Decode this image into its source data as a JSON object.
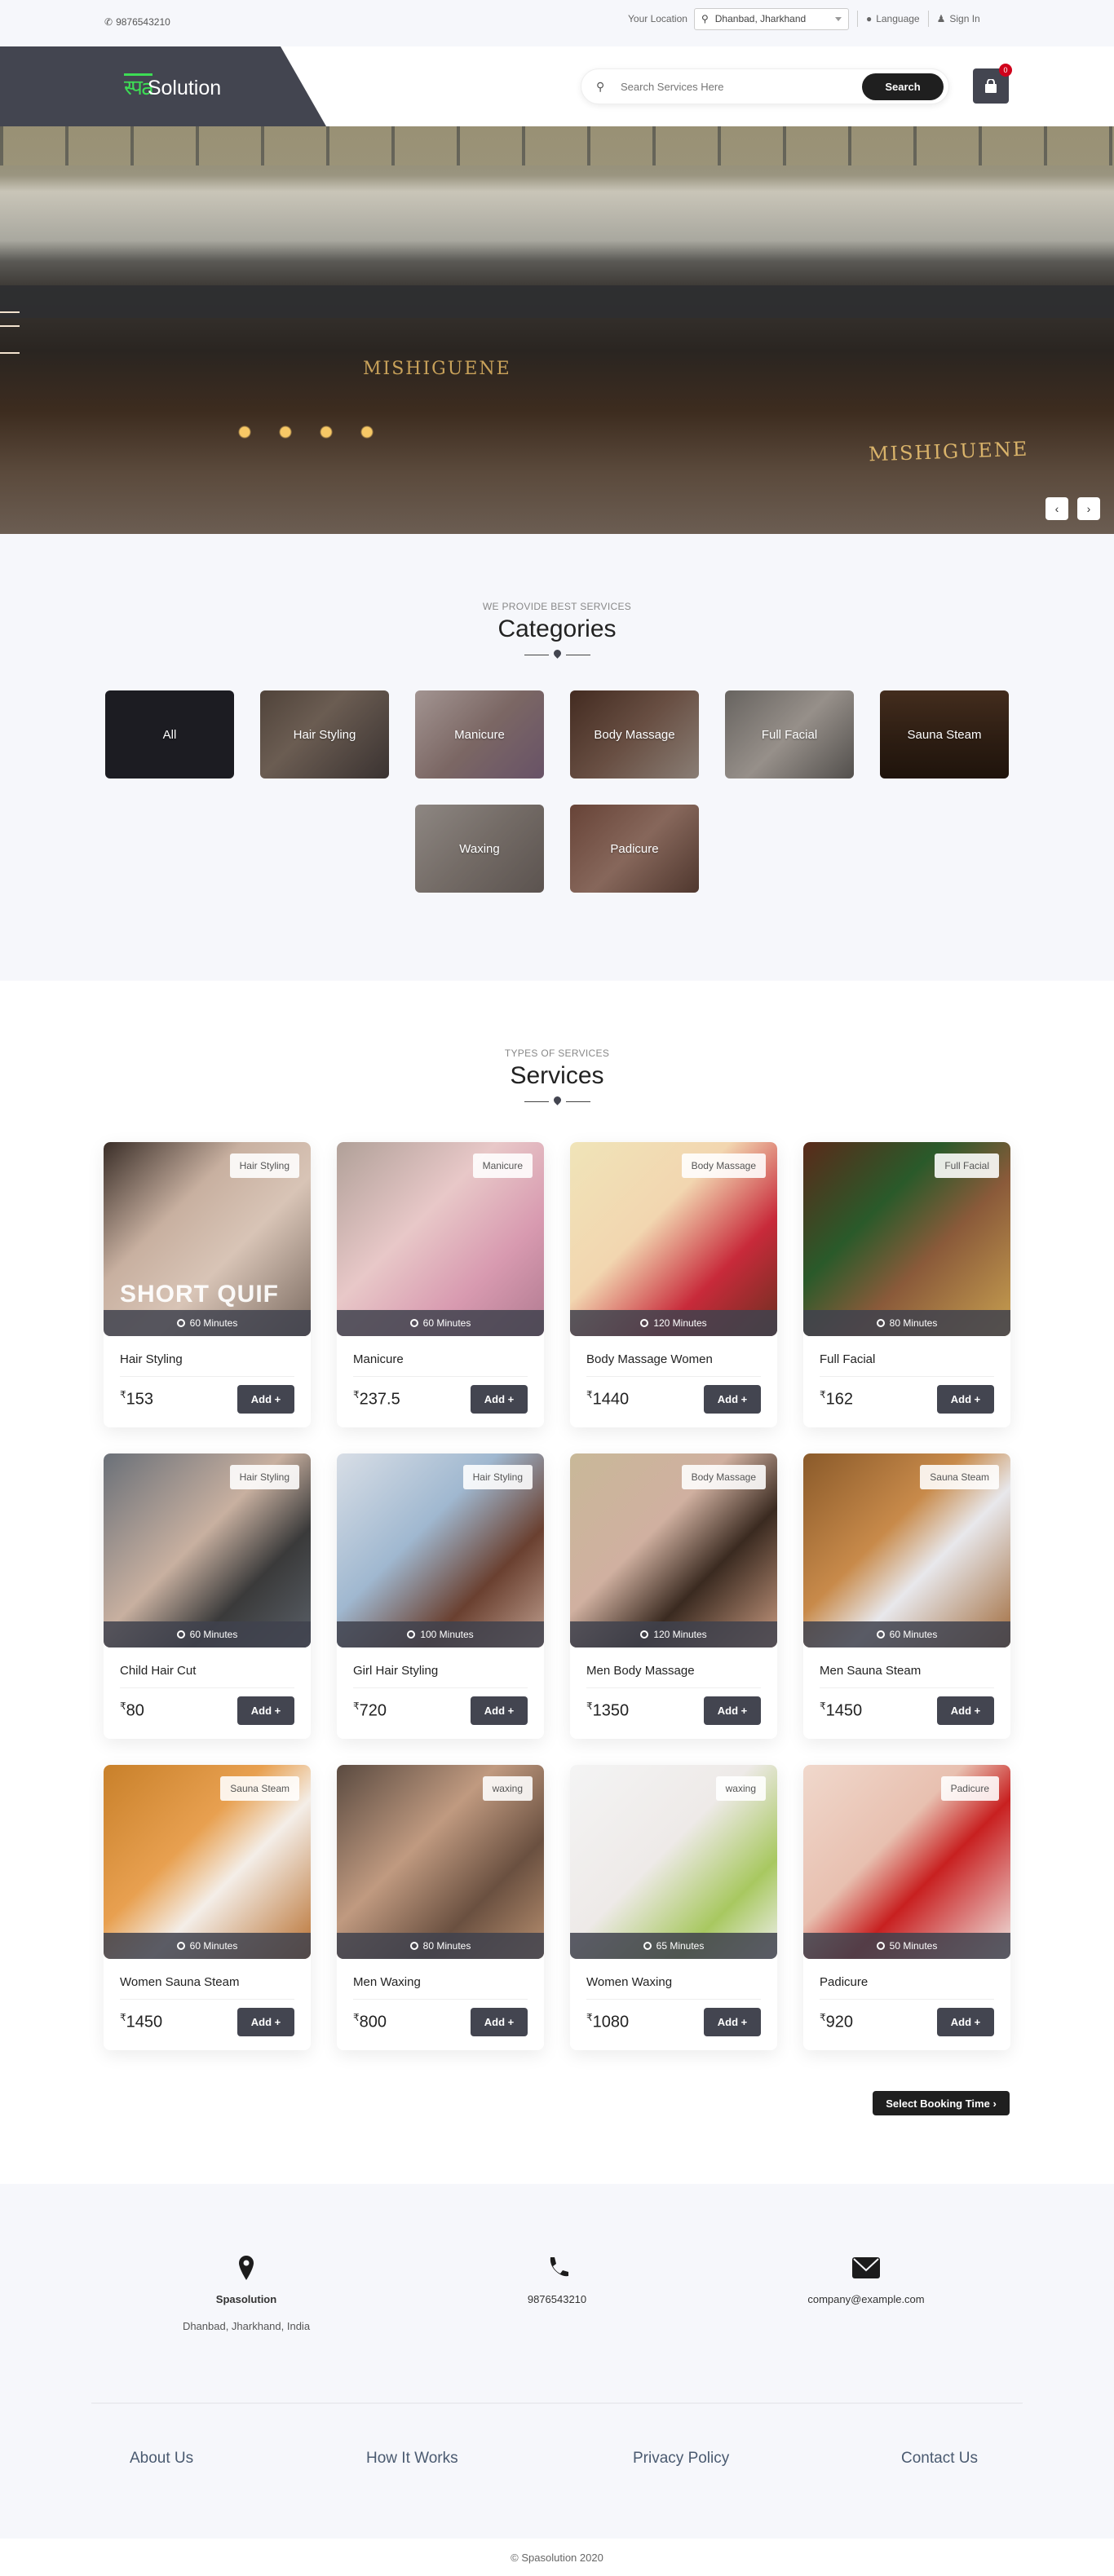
{
  "topbar": {
    "phone": "9876543210",
    "location_label": "Your Location",
    "location_value": "Dhanbad, Jharkhand",
    "language": "Language",
    "sign_in": "Sign In"
  },
  "header": {
    "logo_spa": "स्पa",
    "logo_solution": "Solution",
    "search_placeholder": "Search Services Here",
    "search_button": "Search",
    "cart_count": "0"
  },
  "hero": {
    "sign_left": "MISHIGUENE",
    "sign_right": "MISHIGUENE",
    "prev_icon": "‹",
    "next_icon": "›"
  },
  "categories": {
    "subtitle": "WE PROVIDE BEST SERVICES",
    "title": "Categories",
    "items": [
      {
        "label": "All"
      },
      {
        "label": "Hair Styling"
      },
      {
        "label": "Manicure"
      },
      {
        "label": "Body Massage"
      },
      {
        "label": "Full Facial"
      },
      {
        "label": "Sauna Steam"
      },
      {
        "label": "Waxing"
      },
      {
        "label": "Padicure"
      }
    ]
  },
  "services": {
    "subtitle": "TYPES OF SERVICES",
    "title": "Services",
    "currency": "₹",
    "add_label": "Add +",
    "items": [
      {
        "name": "Hair Styling",
        "tag": "Hair Styling",
        "duration": "60 Minutes",
        "price": "153"
      },
      {
        "name": "Manicure",
        "tag": "Manicure",
        "duration": "60 Minutes",
        "price": "237.5"
      },
      {
        "name": "Body Massage Women",
        "tag": "Body Massage",
        "duration": "120 Minutes",
        "price": "1440"
      },
      {
        "name": "Full Facial",
        "tag": "Full Facial",
        "duration": "80 Minutes",
        "price": "162"
      },
      {
        "name": "Child Hair Cut",
        "tag": "Hair Styling",
        "duration": "60 Minutes",
        "price": "80"
      },
      {
        "name": "Girl Hair Styling",
        "tag": "Hair Styling",
        "duration": "100 Minutes",
        "price": "720"
      },
      {
        "name": "Men Body Massage",
        "tag": "Body Massage",
        "duration": "120 Minutes",
        "price": "1350"
      },
      {
        "name": "Men Sauna Steam",
        "tag": "Sauna Steam",
        "duration": "60 Minutes",
        "price": "1450"
      },
      {
        "name": "Women Sauna Steam",
        "tag": "Sauna Steam",
        "duration": "60 Minutes",
        "price": "1450"
      },
      {
        "name": "Men Waxing",
        "tag": "waxing",
        "duration": "80 Minutes",
        "price": "800"
      },
      {
        "name": "Women Waxing",
        "tag": "waxing",
        "duration": "65 Minutes",
        "price": "1080"
      },
      {
        "name": "Padicure",
        "tag": "Padicure",
        "duration": "50 Minutes",
        "price": "920"
      }
    ],
    "image_overlay_text": "SHORT QUIF",
    "book_button": "Select Booking Time ›"
  },
  "footer": {
    "company": "Spasolution",
    "address": "Dhanbad, Jharkhand, India",
    "phone": "9876543210",
    "email": "company@example.com",
    "links": [
      "About Us",
      "How It Works",
      "Privacy Policy",
      "Contact Us"
    ],
    "copyright": "© Spasolution 2020"
  },
  "colors": {
    "brand_dark": "#434550",
    "logo_green": "#3ddc55",
    "badge_red": "#d0021b",
    "button_black": "#1f1f1f"
  }
}
